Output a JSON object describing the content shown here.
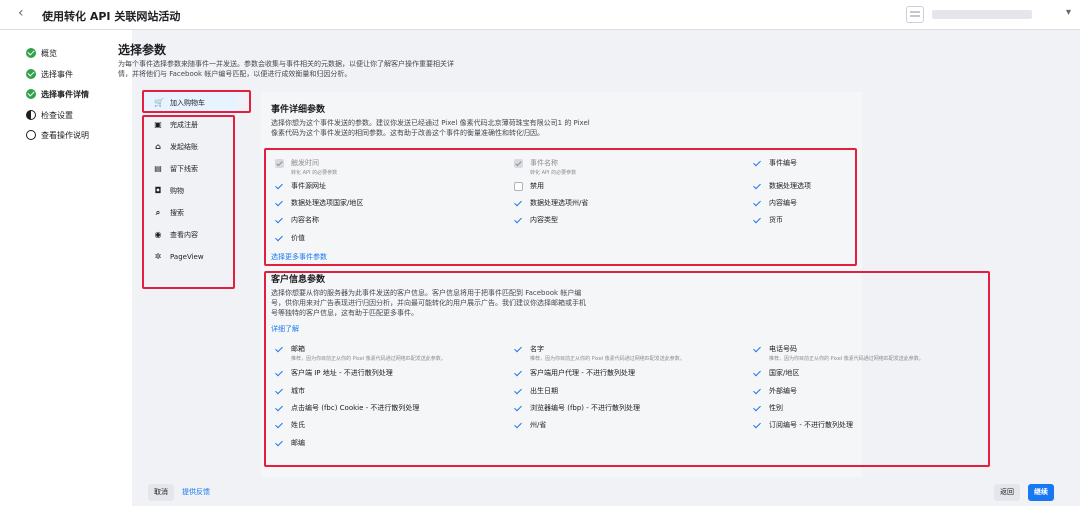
{
  "header": {
    "back_icon": "‹",
    "title": "使用转化 API 关联网站活动"
  },
  "steps": [
    {
      "label": "概览",
      "state": "done"
    },
    {
      "label": "选择事件",
      "state": "done"
    },
    {
      "label": "选择事件详情",
      "state": "done"
    },
    {
      "label": "检查设置",
      "state": "half"
    },
    {
      "label": "查看操作说明",
      "state": "empty"
    }
  ],
  "page": {
    "title": "选择参数",
    "intro": "为每个事件选择参数来随事件一并发送。参数会收集与事件相关的元数据，以便让你了解客户操作重要相关详情，并将他们与 Facebook 帐户编号匹配，以便进行成效衡量和归因分析。"
  },
  "events": [
    {
      "icon": "cart-icon",
      "glyph": "🛒",
      "label": "加入购物车"
    },
    {
      "icon": "registration-icon",
      "glyph": "▣",
      "label": "完成注册"
    },
    {
      "icon": "bank-icon",
      "glyph": "⌂",
      "label": "发起结账"
    },
    {
      "icon": "contact-card-icon",
      "glyph": "▤",
      "label": "留下线索"
    },
    {
      "icon": "bag-icon",
      "glyph": "◘",
      "label": "购物"
    },
    {
      "icon": "search-icon",
      "glyph": "⌕",
      "label": "搜索"
    },
    {
      "icon": "eye-icon",
      "glyph": "◉",
      "label": "查看内容"
    },
    {
      "icon": "pageview-icon",
      "glyph": "✲",
      "label": "PageView"
    }
  ],
  "event_params": {
    "title": "事件详细参数",
    "desc": "选择你想为这个事件发送的参数。建议你发送已经通过 Pixel 像素代码北京薄荷珠宝有限公司1 的 Pixel 像素代码为这个事件发送的相同参数。这有助于改善这个事件的衡量准确性和转化归因。",
    "items": [
      {
        "label": "触发时间",
        "sub": "转化 API 的必要参数",
        "state": "disabled"
      },
      {
        "label": "事件名称",
        "sub": "转化 API 的必要参数",
        "state": "disabled"
      },
      {
        "label": "事件编号",
        "sub": "",
        "state": "on"
      },
      {
        "label": "事件源网址",
        "sub": "",
        "state": "on"
      },
      {
        "label": "禁用",
        "sub": "",
        "state": "off"
      },
      {
        "label": "数据处理选项",
        "sub": "",
        "state": "on"
      },
      {
        "label": "数据处理选项国家/地区",
        "sub": "",
        "state": "on"
      },
      {
        "label": "数据处理选项州/省",
        "sub": "",
        "state": "on"
      },
      {
        "label": "内容编号",
        "sub": "",
        "state": "on"
      },
      {
        "label": "内容名称",
        "sub": "",
        "state": "on"
      },
      {
        "label": "内容类型",
        "sub": "",
        "state": "on"
      },
      {
        "label": "货币",
        "sub": "",
        "state": "on"
      },
      {
        "label": "价值",
        "sub": "",
        "state": "on"
      }
    ],
    "more_link": "选择更多事件参数"
  },
  "customer_params": {
    "title": "客户信息参数",
    "desc": "选择你想要从你的服务器为此事件发送的客户信息。客户信息将用于把事件匹配到 Facebook 帐户编号，供你用来对广告表现进行归因分析，并向最可能转化的用户展示广告。我们建议你选择邮箱或手机号等独特的客户信息，这有助于匹配更多事件。",
    "learn_more": "详细了解",
    "items": [
      {
        "label": "邮箱",
        "sub": "推荐，因为你目前正从你的 Pixel 像素代码通过网络匹配发送此参数。"
      },
      {
        "label": "名字",
        "sub": "推荐，因为你目前正从你的 Pixel 像素代码通过网络匹配发送此参数。"
      },
      {
        "label": "电话号码",
        "sub": "推荐，因为你目前正从你的 Pixel 像素代码通过网络匹配发送此参数。"
      },
      {
        "label": "客户端 IP 地址 - 不进行散列处理",
        "sub": ""
      },
      {
        "label": "客户端用户代理 - 不进行散列处理",
        "sub": ""
      },
      {
        "label": "国家/地区",
        "sub": ""
      },
      {
        "label": "城市",
        "sub": ""
      },
      {
        "label": "出生日期",
        "sub": ""
      },
      {
        "label": "外部编号",
        "sub": ""
      },
      {
        "label": "点击编号 (fbc) Cookie - 不进行散列处理",
        "sub": ""
      },
      {
        "label": "浏览器编号 (fbp) - 不进行散列处理",
        "sub": ""
      },
      {
        "label": "性别",
        "sub": ""
      },
      {
        "label": "姓氏",
        "sub": ""
      },
      {
        "label": "州/省",
        "sub": ""
      },
      {
        "label": "订阅编号 - 不进行散列处理",
        "sub": ""
      },
      {
        "label": "邮编",
        "sub": ""
      }
    ]
  },
  "footer": {
    "cancel": "取消",
    "feedback": "提供反馈",
    "back": "返回",
    "continue": "继续"
  },
  "colors": {
    "accent": "#1877f2",
    "done": "#31a24c",
    "highlight": "#e41e3f"
  }
}
